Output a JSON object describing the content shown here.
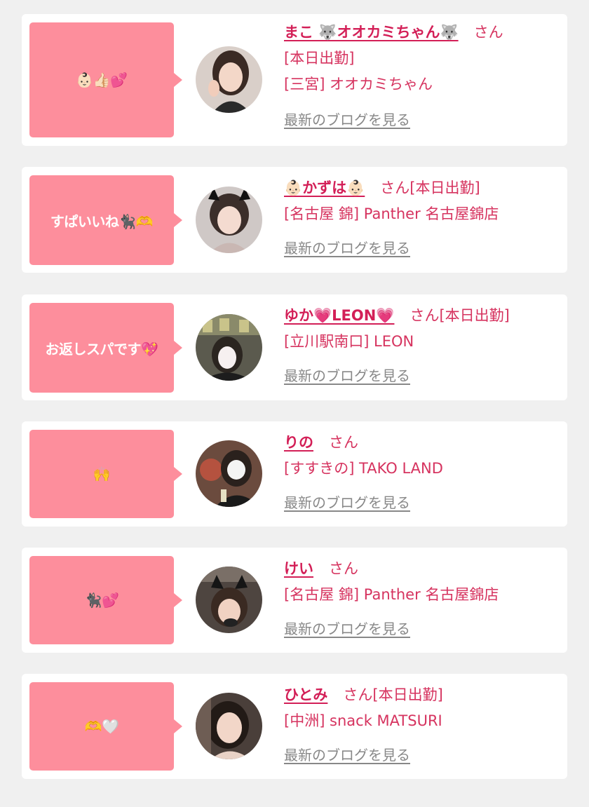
{
  "theme": {
    "bubble_color": "#fd8e9c",
    "text_color": "#d6335f",
    "link_gray": "#888888"
  },
  "entries": [
    {
      "comment": "👶🏻👍🏻💕",
      "name": "まこ 🐺オオカミちゃん🐺",
      "suffix": "さん",
      "status": "",
      "line2": "[本日出勤]",
      "line3": "[三宮] オオカミちゃん",
      "blog_link": "最新のブログを見る"
    },
    {
      "comment": "すぱいいね🐈‍⬛🫶",
      "name": "👶🏻かずは👶🏻",
      "suffix": "さん",
      "status": "[本日出勤]",
      "line2": "[名古屋 錦] Panther 名古屋錦店",
      "line3": "",
      "blog_link": "最新のブログを見る"
    },
    {
      "comment": "お返しスパです💖",
      "name": "ゆか💗LEON💗",
      "suffix": "さん",
      "status": "[本日出勤]",
      "line2": "[立川駅南口] LEON",
      "line3": "",
      "blog_link": "最新のブログを見る"
    },
    {
      "comment": "🙌",
      "name": "りの",
      "suffix": "さん",
      "status": "",
      "line2": "[すすきの] TAKO LAND",
      "line3": "",
      "blog_link": "最新のブログを見る"
    },
    {
      "comment": "🐈‍⬛💕",
      "name": "けい",
      "suffix": "さん",
      "status": "",
      "line2": "[名古屋 錦] Panther 名古屋錦店",
      "line3": "",
      "blog_link": "最新のブログを見る"
    },
    {
      "comment": "🫶🤍",
      "name": "ひとみ",
      "suffix": "さん",
      "status": "[本日出勤]",
      "line2": "[中洲] snack MATSURI",
      "line3": "",
      "blog_link": "最新のブログを見る"
    }
  ]
}
